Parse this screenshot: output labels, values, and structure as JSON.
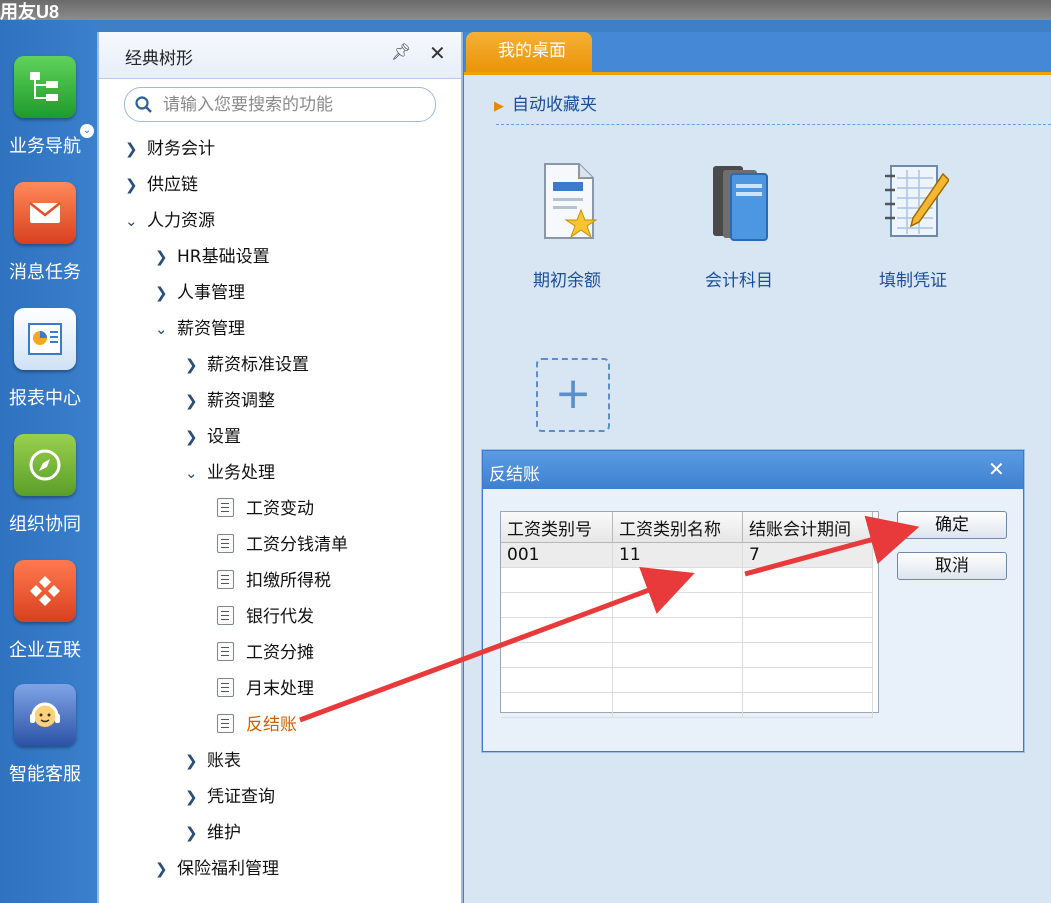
{
  "app": {
    "logo": "用友U8"
  },
  "rail": [
    {
      "label": "业务导航",
      "icon": "tree-nav-icon",
      "color": "#27a83a"
    },
    {
      "label": "消息任务",
      "icon": "mail-icon",
      "color": "#e8502e"
    },
    {
      "label": "报表中心",
      "icon": "report-icon",
      "color": "#4a90d8"
    },
    {
      "label": "组织协同",
      "icon": "compass-icon",
      "color": "#6cb33e"
    },
    {
      "label": "企业互联",
      "icon": "connect-icon",
      "color": "#e85a2e"
    },
    {
      "label": "智能客服",
      "icon": "headset-icon",
      "color": "#3a66b8"
    }
  ],
  "tree": {
    "title": "经典树形",
    "search_placeholder": "请输入您要搜索的功能",
    "nodes": [
      {
        "label": "财务会计"
      },
      {
        "label": "供应链"
      },
      {
        "label": "人力资源"
      },
      {
        "label": "HR基础设置"
      },
      {
        "label": "人事管理"
      },
      {
        "label": "薪资管理"
      },
      {
        "label": "薪资标准设置"
      },
      {
        "label": "薪资调整"
      },
      {
        "label": "设置"
      },
      {
        "label": "业务处理"
      },
      {
        "label": "工资变动"
      },
      {
        "label": "工资分钱清单"
      },
      {
        "label": "扣缴所得税"
      },
      {
        "label": "银行代发"
      },
      {
        "label": "工资分摊"
      },
      {
        "label": "月末处理"
      },
      {
        "label": "反结账"
      },
      {
        "label": "账表"
      },
      {
        "label": "凭证查询"
      },
      {
        "label": "维护"
      },
      {
        "label": "保险福利管理"
      }
    ]
  },
  "desk": {
    "tab": "我的桌面",
    "favorites_title": "自动收藏夹",
    "shortcuts": [
      {
        "label": "期初余额",
        "icon": "document-star-icon"
      },
      {
        "label": "会计科目",
        "icon": "books-icon"
      },
      {
        "label": "填制凭证",
        "icon": "notebook-pencil-icon"
      }
    ]
  },
  "dialog": {
    "title": "反结账",
    "columns": [
      "工资类别号",
      "工资类别名称",
      "结账会计期间"
    ],
    "rows": [
      [
        "001",
        "11",
        "7"
      ]
    ],
    "ok": "确定",
    "cancel": "取消"
  },
  "colors": {
    "accent": "#f0a000",
    "rail": "#3b80cc",
    "arrow": "#e83a3a"
  }
}
